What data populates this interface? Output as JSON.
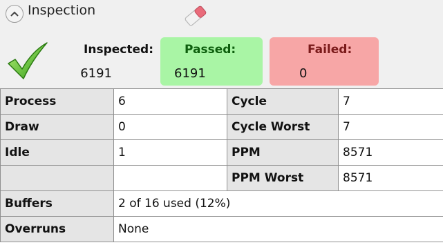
{
  "header": {
    "title": "Inspection",
    "collapse_icon": "chevron-up-icon",
    "clear_icon": "eraser-icon",
    "status_icon": "green-checkmark-icon"
  },
  "counters": {
    "inspected": {
      "label": "Inspected:",
      "value": "6191"
    },
    "passed": {
      "label": "Passed:",
      "value": "6191",
      "color": "#a9f5a5"
    },
    "failed": {
      "label": "Failed:",
      "value": "0",
      "color": "#f7a6a6"
    }
  },
  "stats": {
    "process": {
      "label": "Process",
      "value": "6"
    },
    "draw": {
      "label": "Draw",
      "value": "0"
    },
    "idle": {
      "label": "Idle",
      "value": "1"
    },
    "empty": {
      "label": "",
      "value": ""
    },
    "cycle": {
      "label": "Cycle",
      "value": "7"
    },
    "cycle_worst": {
      "label": "Cycle Worst",
      "value": "7"
    },
    "ppm": {
      "label": "PPM",
      "value": "8571"
    },
    "ppm_worst": {
      "label": "PPM Worst",
      "value": "8571"
    },
    "buffers": {
      "label": "Buffers",
      "value": "2 of 16 used (12%)"
    },
    "overruns": {
      "label": "Overruns",
      "value": "None"
    }
  }
}
